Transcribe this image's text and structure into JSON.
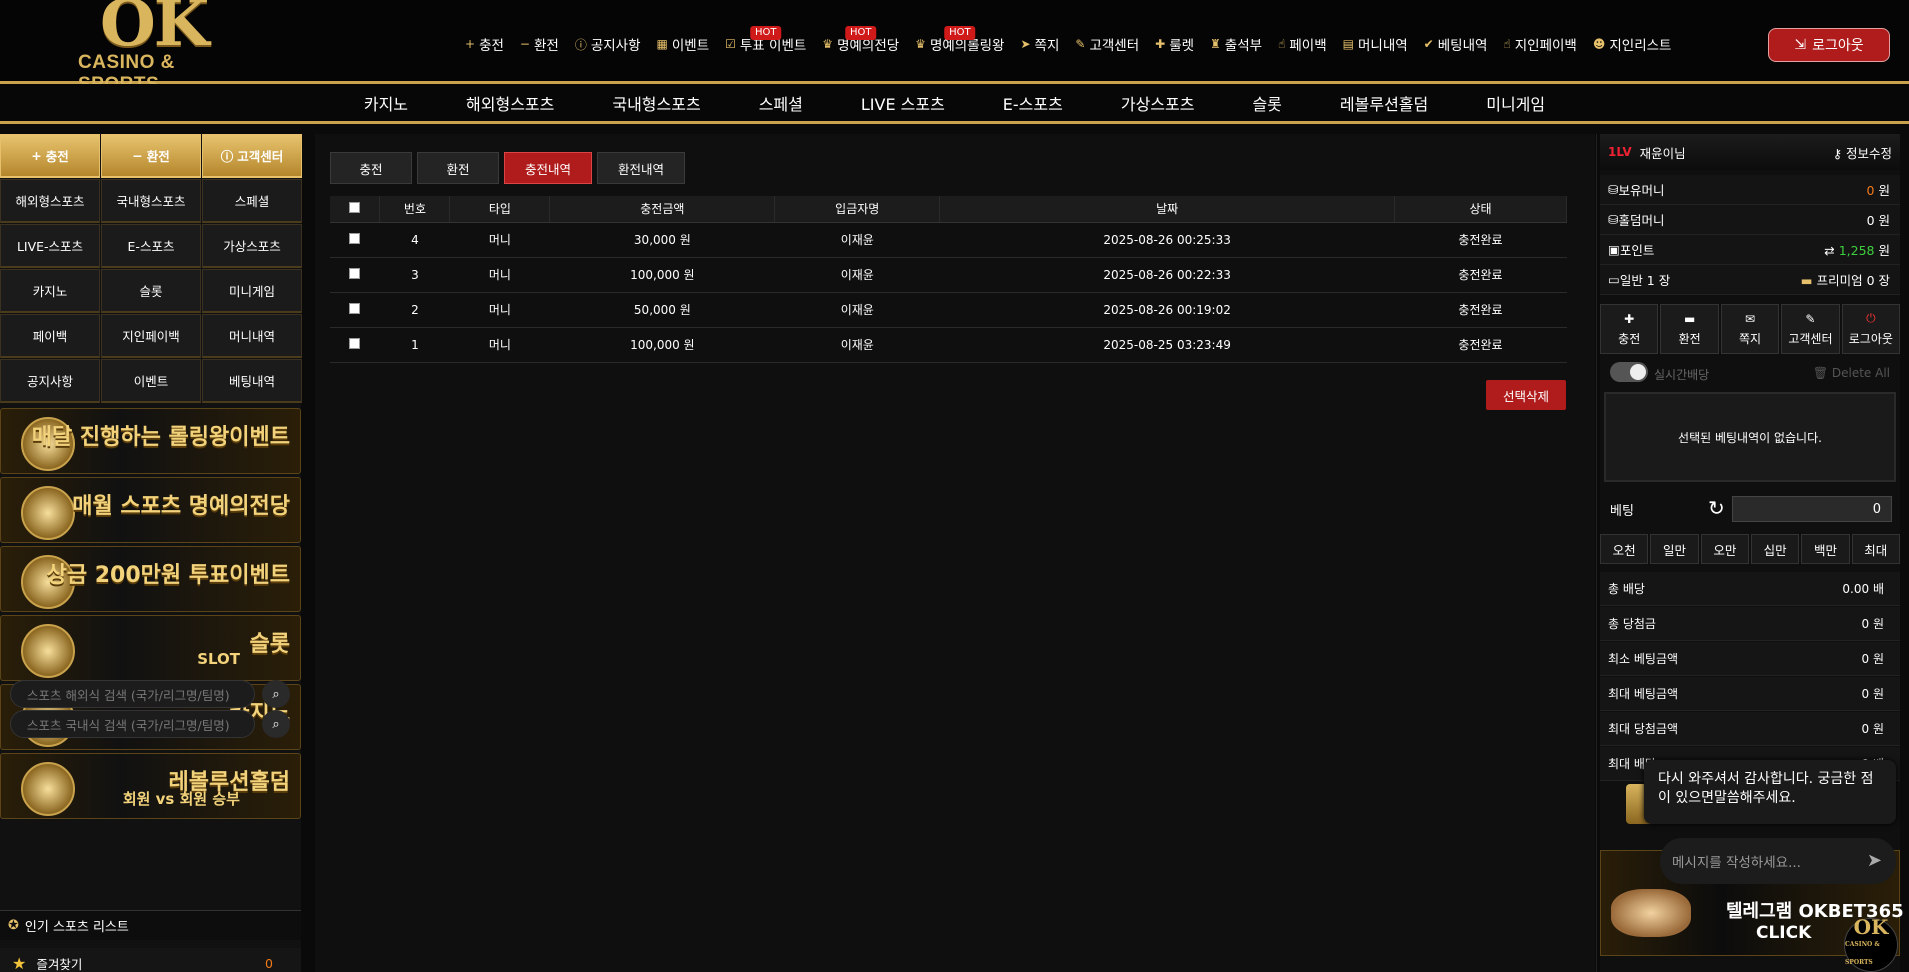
{
  "header": {
    "logo_main": "OK",
    "logo_sub": "CASINO & SPORTS",
    "nav": [
      {
        "label": "충전",
        "icon": "plus-icon",
        "hot": false
      },
      {
        "label": "환전",
        "icon": "minus-icon",
        "hot": false
      },
      {
        "label": "공지사항",
        "icon": "info-icon",
        "hot": false
      },
      {
        "label": "이벤트",
        "icon": "calendar-icon",
        "hot": false
      },
      {
        "label": "투표 이벤트",
        "icon": "vote-icon",
        "hot": true
      },
      {
        "label": "명예의전당",
        "icon": "trophy-icon",
        "hot": true
      },
      {
        "label": "명예의롤링왕",
        "icon": "trophy-icon",
        "hot": true
      },
      {
        "label": "쪽지",
        "icon": "send-icon",
        "hot": false
      },
      {
        "label": "고객센터",
        "icon": "edit-icon",
        "hot": false
      },
      {
        "label": "룰렛",
        "icon": "gift-icon",
        "hot": false
      },
      {
        "label": "출석부",
        "icon": "stamp-icon",
        "hot": false
      },
      {
        "label": "페이백",
        "icon": "hand-icon",
        "hot": false
      },
      {
        "label": "머니내역",
        "icon": "clipboard-icon",
        "hot": false
      },
      {
        "label": "베팅내역",
        "icon": "check-icon",
        "hot": false
      },
      {
        "label": "지인페이백",
        "icon": "hand-icon",
        "hot": false
      },
      {
        "label": "지인리스트",
        "icon": "users-icon",
        "hot": false
      }
    ],
    "hot_label": "HOT",
    "logout_label": "로그아웃"
  },
  "categories": [
    "카지노",
    "해외형스포츠",
    "국내형스포츠",
    "스페셜",
    "LIVE 스포츠",
    "E-스포츠",
    "가상스포츠",
    "슬롯",
    "레볼루션홀덤",
    "미니게임"
  ],
  "left": {
    "buttons": [
      {
        "label": "충전",
        "gold": true,
        "icon": "plus"
      },
      {
        "label": "환전",
        "gold": true,
        "icon": "minus"
      },
      {
        "label": "고객센터",
        "gold": true,
        "icon": "info"
      },
      {
        "label": "해외형스포츠"
      },
      {
        "label": "국내형스포츠"
      },
      {
        "label": "스페셜"
      },
      {
        "label": "LIVE-스포츠"
      },
      {
        "label": "E-스포츠"
      },
      {
        "label": "가상스포츠"
      },
      {
        "label": "카지노"
      },
      {
        "label": "슬롯"
      },
      {
        "label": "미니게임"
      },
      {
        "label": "페이백"
      },
      {
        "label": "지인페이백"
      },
      {
        "label": "머니내역"
      },
      {
        "label": "공지사항"
      },
      {
        "label": "이벤트"
      },
      {
        "label": "베팅내역"
      }
    ],
    "banners": [
      {
        "text": "매달 진행하는 롤링왕이벤트",
        "sub": ""
      },
      {
        "text": "매월 스포츠 명예의전당",
        "sub": ""
      },
      {
        "text": "상금 200만원 투표이벤트",
        "sub": ""
      },
      {
        "text": "슬롯",
        "sub": "SLOT"
      },
      {
        "text": "카지노",
        "sub": "CASINO"
      },
      {
        "text": "레볼루션홀덤",
        "sub": "회원 vs 회원 승부"
      }
    ],
    "search1_placeholder": "스포츠 해외식 검색 (국가/리그명/팀명)",
    "search2_placeholder": "스포츠 국내식 검색 (국가/리그명/팀명)",
    "popular_title": "인기 스포츠 리스트",
    "fav_label": "즐겨찾기",
    "fav_count": "0"
  },
  "main": {
    "tabs": [
      {
        "label": "충전",
        "active": false
      },
      {
        "label": "환전",
        "active": false
      },
      {
        "label": "충전내역",
        "active": true
      },
      {
        "label": "환전내역",
        "active": false
      }
    ],
    "columns": [
      "번호",
      "타입",
      "충전금액",
      "입금자명",
      "날짜",
      "상태"
    ],
    "rows": [
      {
        "no": "4",
        "type": "머니",
        "amount": "30,000 원",
        "name": "이재윤",
        "date": "2025-08-26 00:25:33",
        "status": "충전완료"
      },
      {
        "no": "3",
        "type": "머니",
        "amount": "100,000 원",
        "name": "이재윤",
        "date": "2025-08-26 00:22:33",
        "status": "충전완료"
      },
      {
        "no": "2",
        "type": "머니",
        "amount": "50,000 원",
        "name": "이재윤",
        "date": "2025-08-26 00:19:02",
        "status": "충전완료"
      },
      {
        "no": "1",
        "type": "머니",
        "amount": "100,000 원",
        "name": "이재윤",
        "date": "2025-08-25 03:23:49",
        "status": "충전완료"
      }
    ],
    "delete_selected": "선택삭제"
  },
  "right": {
    "level": "1LV",
    "username": "재윤이님",
    "edit_label": "정보수정",
    "money_label": "보유머니",
    "money_value": "0",
    "money_unit": "원",
    "hold_label": "홀덤머니",
    "hold_value": "0 원",
    "point_label": "포인트",
    "point_value": "1,258",
    "point_unit": "원",
    "general_label": "일반 1 장",
    "premium_label": "프리미엄 0 장",
    "actions": [
      {
        "label": "충전",
        "icon": "plus"
      },
      {
        "label": "환전",
        "icon": "minus"
      },
      {
        "label": "쪽지",
        "icon": "mail"
      },
      {
        "label": "고객센터",
        "icon": "edit"
      },
      {
        "label": "로그아웃",
        "icon": "power"
      }
    ],
    "realtime_label": "실시간배당",
    "delete_all": "Delete All",
    "empty_msg": "선택된 베팅내역이 없습니다.",
    "bet_label": "베팅",
    "bet_value": "0",
    "chips": [
      "오천",
      "일만",
      "오만",
      "십만",
      "백만",
      "최대"
    ],
    "stats": [
      {
        "label": "총 배당",
        "value": "0.00 배"
      },
      {
        "label": "총 당첨금",
        "value": "0 원"
      },
      {
        "label": "최소 베팅금액",
        "value": "0 원"
      },
      {
        "label": "최대 베팅금액",
        "value": "0 원"
      },
      {
        "label": "최대 당첨금액",
        "value": "0 원"
      },
      {
        "label": "최대 배당",
        "value": "0 배"
      }
    ],
    "telegram_text": "텔레그램 OKBET365",
    "telegram_click": "CLICK"
  },
  "chat": {
    "message": "다시 와주셔서 감사합니다. 궁금한 점이 있으면말씀해주세요.",
    "input_placeholder": "메시지를 작성하세요..."
  },
  "badge": {
    "main": "OK",
    "sub": "CASINO & SPORTS"
  },
  "colors": {
    "gold": "#c8a24c",
    "red": "#b01c1c",
    "point_green": "#3ecf3e",
    "money_orange": "#f07a1a"
  }
}
